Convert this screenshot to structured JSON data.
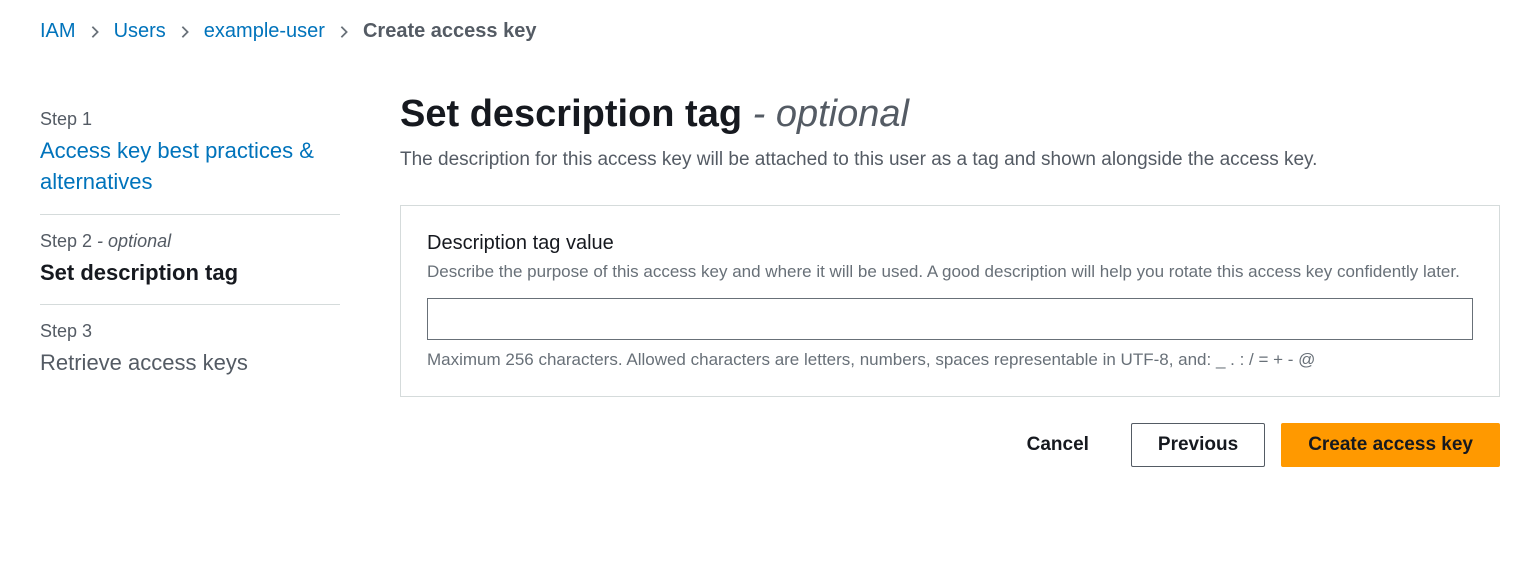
{
  "breadcrumb": {
    "items": [
      {
        "label": "IAM",
        "link": true
      },
      {
        "label": "Users",
        "link": true
      },
      {
        "label": "example-user",
        "link": true
      },
      {
        "label": "Create access key",
        "link": false
      }
    ]
  },
  "sidebar": {
    "steps": [
      {
        "label": "Step 1",
        "optional": "",
        "title": "Access key best practices & alternatives",
        "state": "link"
      },
      {
        "label": "Step 2",
        "optional": " - optional",
        "title": "Set description tag",
        "state": "active"
      },
      {
        "label": "Step 3",
        "optional": "",
        "title": "Retrieve access keys",
        "state": "pending"
      }
    ]
  },
  "main": {
    "title": "Set description tag",
    "title_separator": " - ",
    "title_optional": "optional",
    "description": "The description for this access key will be attached to this user as a tag and shown alongside the access key.",
    "field": {
      "label": "Description tag value",
      "help": "Describe the purpose of this access key and where it will be used. A good description will help you rotate this access key confidently later.",
      "value": "",
      "placeholder": "",
      "constraint": "Maximum 256 characters. Allowed characters are letters, numbers, spaces representable in UTF-8, and: _ . : / = + - @"
    }
  },
  "actions": {
    "cancel": "Cancel",
    "previous": "Previous",
    "create": "Create access key"
  }
}
